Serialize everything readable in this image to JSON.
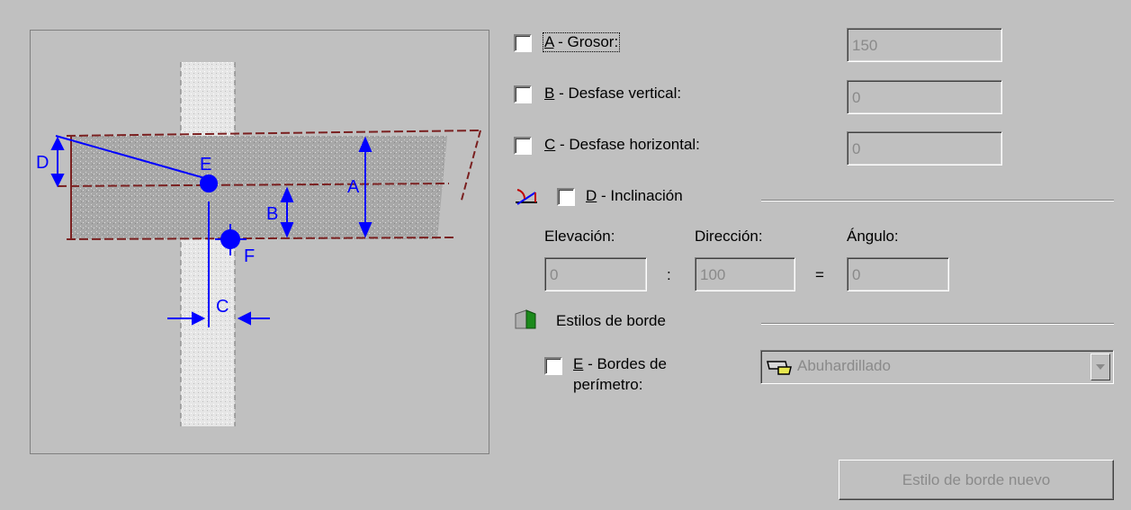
{
  "preview": {
    "labels": {
      "a": "A",
      "b": "B",
      "c": "C",
      "d": "D",
      "e": "E",
      "f": "F"
    }
  },
  "thickness": {
    "label_key": "A",
    "label_rest": " - Grosor:",
    "value": "150"
  },
  "vertical_offset": {
    "label_key": "B",
    "label_rest": " - Desfase vertical:",
    "value": "0"
  },
  "horizontal_offset": {
    "label_key": "C",
    "label_rest": " - Desfase horizontal:",
    "value": "0"
  },
  "slope": {
    "label_key": "D",
    "label_rest": " - Inclinación",
    "elevation_label": "Elevación:",
    "direction_label": "Dirección:",
    "angle_label": "Ángulo:",
    "elevation_value": "0",
    "direction_value": "100",
    "angle_value": "0",
    "colon": ":",
    "equals": "="
  },
  "edge_styles": {
    "title": "Estilos de borde",
    "perimeter_key": "E",
    "perimeter_rest_line1": " - Bordes de",
    "perimeter_line2": "perímetro:",
    "selected_style": "Abuhardillado",
    "new_style_button": "Estilo de borde nuevo"
  },
  "colors": {
    "accent": "#0000ff",
    "disabled_text": "#8a8a8a",
    "panel": "#c0c0c0"
  }
}
